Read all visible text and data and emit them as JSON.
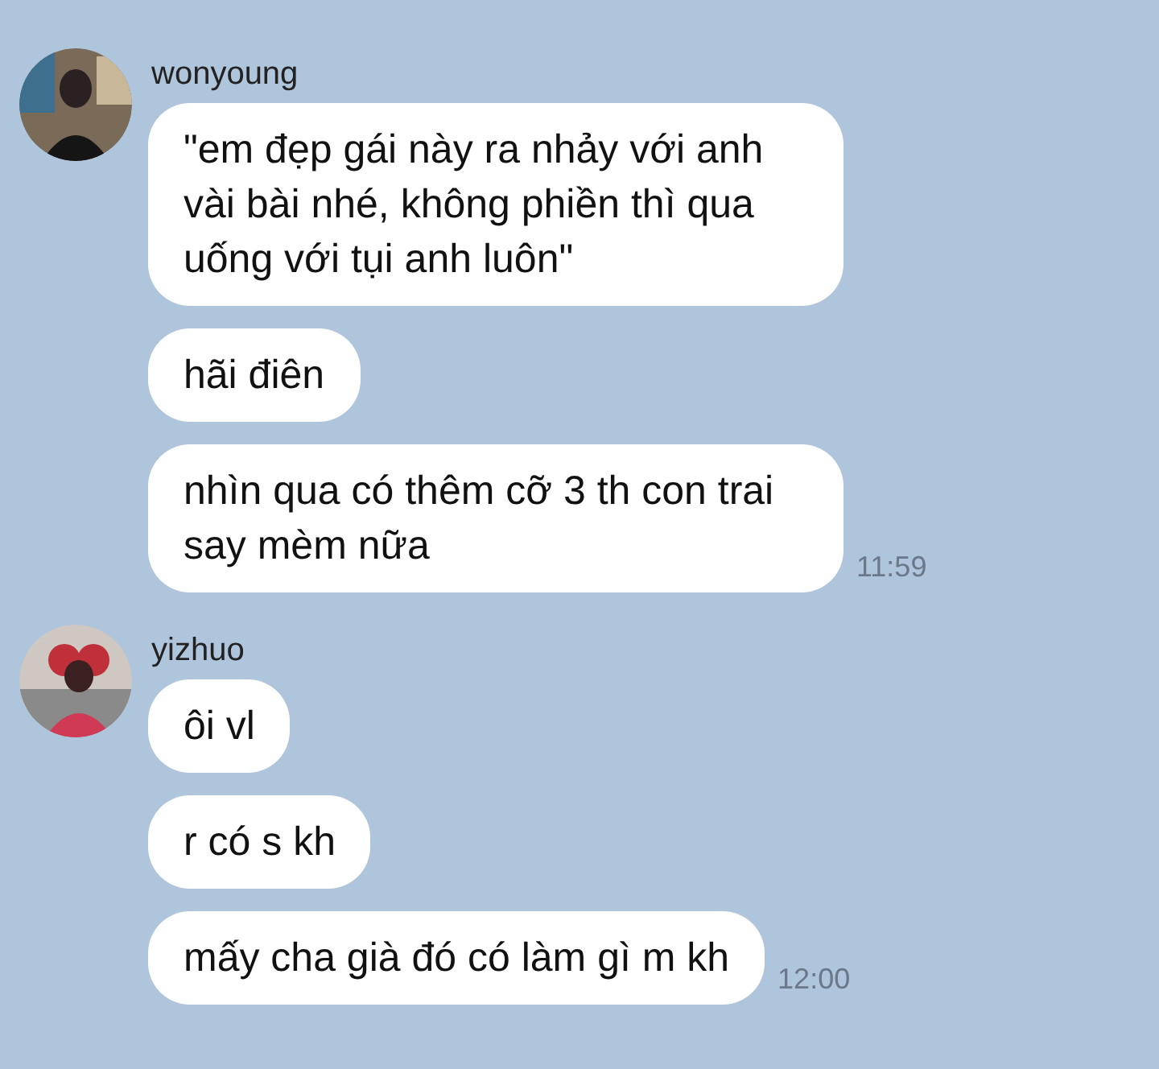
{
  "groups": [
    {
      "sender": "wonyoung",
      "messages": [
        {
          "text": "\"em đẹp gái này ra nhảy với anh vài bài nhé, không phiền thì qua uống với tụi anh luôn\""
        },
        {
          "text": "hãi điên"
        },
        {
          "text": "nhìn qua có thêm cỡ 3 th con trai say mèm nữa"
        }
      ],
      "time": "11:59"
    },
    {
      "sender": "yizhuo",
      "messages": [
        {
          "text": "ôi vl"
        },
        {
          "text": "r có s kh"
        },
        {
          "text": "mấy cha già đó có làm gì m kh"
        }
      ],
      "time": "12:00"
    }
  ]
}
